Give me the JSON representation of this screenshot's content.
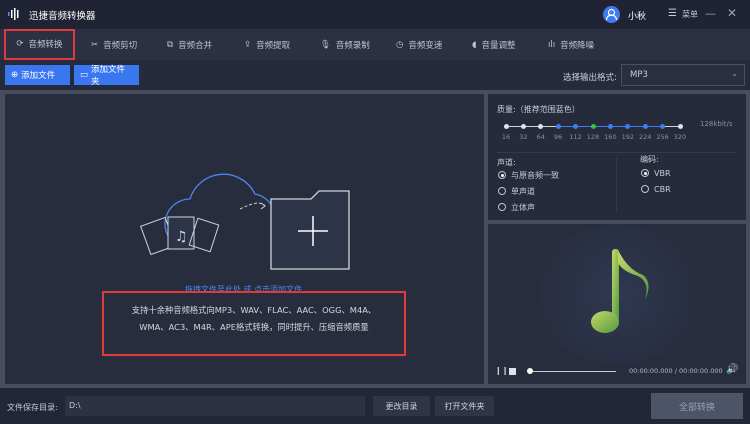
{
  "app": {
    "title": "迅捷音频转换器",
    "user": "小秋",
    "menu": "菜单"
  },
  "tabs": [
    {
      "label": "音频转换",
      "icon": "convert-icon"
    },
    {
      "label": "音频剪切",
      "icon": "scissors-icon"
    },
    {
      "label": "音频合并",
      "icon": "merge-icon"
    },
    {
      "label": "音频提取",
      "icon": "extract-icon"
    },
    {
      "label": "音频录制",
      "icon": "mic-icon"
    },
    {
      "label": "音频变速",
      "icon": "speed-icon"
    },
    {
      "label": "音量调整",
      "icon": "volume-icon"
    },
    {
      "label": "音频降噪",
      "icon": "denoise-icon"
    }
  ],
  "toolbar": {
    "add_file": "添加文件",
    "add_folder": "添加文件夹",
    "format_label": "选择输出格式:",
    "format_value": "MP3"
  },
  "drop": {
    "hint": "拖拽文件至此处 或 点击添加文件",
    "desc1": "支持十余种音频格式向MP3、WAV、FLAC、AAC、OGG、M4A、",
    "desc2": "WMA、AC3、M4R、APE格式转换，同时提升、压缩音频质量"
  },
  "quality": {
    "label": "质量:（推荐范围蓝色）",
    "ticks": [
      "16",
      "32",
      "64",
      "96",
      "112",
      "128",
      "160",
      "192",
      "224",
      "256",
      "320"
    ],
    "selected_index": 5,
    "readout": "128kbit/s"
  },
  "channel": {
    "label": "声道:",
    "options": [
      "与原音频一致",
      "单声道",
      "立体声"
    ],
    "selected": 0
  },
  "encoding": {
    "label": "编码:",
    "options": [
      "VBR",
      "CBR"
    ],
    "selected": 0
  },
  "player": {
    "time": "00:00:00.000 / 00:00:00.000",
    "progress": 0
  },
  "bottom": {
    "save_label": "文件保存目录:",
    "path": "D:\\",
    "change_dir": "更改目录",
    "open_folder": "打开文件夹",
    "convert_all": "全部转换"
  }
}
